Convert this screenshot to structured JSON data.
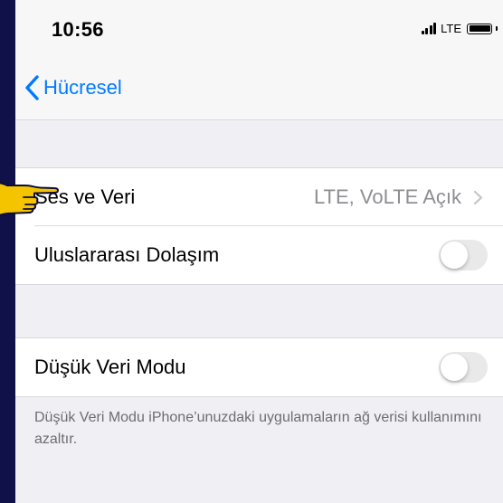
{
  "status_bar": {
    "time": "10:56",
    "network": "LTE"
  },
  "nav": {
    "back_label": "Hücresel"
  },
  "section1": {
    "rows": [
      {
        "label": "Ses ve Veri",
        "value": "LTE, VoLTE Açık"
      },
      {
        "label": "Uluslararası Dolaşım",
        "toggle_on": false
      }
    ]
  },
  "section2": {
    "rows": [
      {
        "label": "Düşük Veri Modu",
        "toggle_on": false
      }
    ],
    "footer": "Düşük Veri Modu iPhone’unuzdaki uygulamaların ağ verisi kullanımını azaltır."
  },
  "colors": {
    "accent": "#007aff",
    "frame": "#11114a",
    "pointer": "#f5c400",
    "toggle_off": "#e9e9ea"
  },
  "icons": {
    "back": "chevron-left-icon",
    "pointer": "pointing-hand-icon"
  }
}
